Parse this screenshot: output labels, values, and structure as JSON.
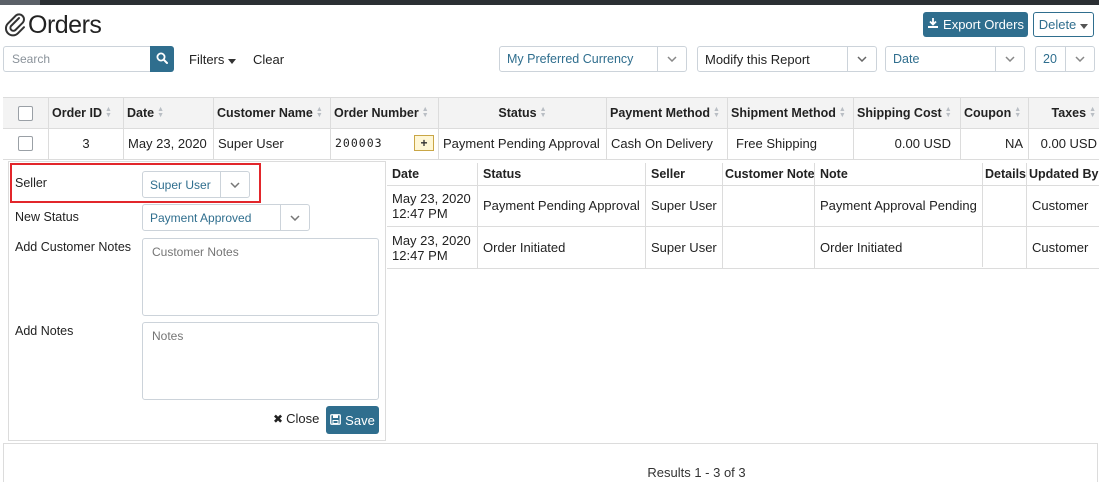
{
  "page": {
    "title": "Orders"
  },
  "toolbar": {
    "export_label": "Export Orders",
    "delete_label": "Delete",
    "search_placeholder": "Search",
    "filters_label": "Filters",
    "clear_label": "Clear",
    "currency_select": "My Preferred Currency",
    "report_select": "Modify this Report",
    "date_select": "Date",
    "page_size_select": "20"
  },
  "table": {
    "columns": [
      "Order ID",
      "Date",
      "Customer Name",
      "Order Number",
      "Status",
      "Payment Method",
      "Shipment Method",
      "Shipping Cost",
      "Coupon",
      "Taxes"
    ],
    "row": {
      "order_id": "3",
      "date": "May 23, 2020",
      "customer_name": "Super User",
      "order_number": "200003",
      "status": "Payment Pending Approval",
      "payment_method": "Cash On Delivery",
      "shipment_method": "Free Shipping",
      "shipping_cost": "0.00 USD",
      "coupon": "NA",
      "taxes": "0.00 USD"
    }
  },
  "detail_form": {
    "seller_label": "Seller",
    "seller_value": "Super User",
    "new_status_label": "New Status",
    "new_status_value": "Payment Approved",
    "customer_notes_label": "Add Customer Notes",
    "customer_notes_placeholder": "Customer Notes",
    "notes_label": "Add Notes",
    "notes_placeholder": "Notes",
    "close_label": "Close",
    "save_label": "Save"
  },
  "history": {
    "columns": [
      "Date",
      "Status",
      "Seller",
      "Customer Note",
      "Note",
      "Details",
      "Updated By"
    ],
    "rows": [
      {
        "date_line1": "May 23, 2020",
        "date_line2": "12:47 PM",
        "status": "Payment Pending Approval",
        "seller": "Super User",
        "customer_note": "",
        "note": "Payment Approval Pending",
        "details": "",
        "updated_by": "Customer"
      },
      {
        "date_line1": "May 23, 2020",
        "date_line2": "12:47 PM",
        "status": "Order Initiated",
        "seller": "Super User",
        "customer_note": "",
        "note": "Order Initiated",
        "details": "",
        "updated_by": "Customer"
      }
    ]
  },
  "footer": {
    "results_text": "Results 1 - 3 of 3"
  },
  "colors": {
    "primary": "#2f6e8e",
    "highlight_border": "#e2262b",
    "header_bg": "#f3f3f3"
  },
  "icons": [
    "paperclip-icon",
    "download-icon",
    "caret-down-icon",
    "search-icon",
    "chevron-down-icon",
    "sort-icon",
    "plus-icon",
    "close-icon",
    "save-icon"
  ]
}
